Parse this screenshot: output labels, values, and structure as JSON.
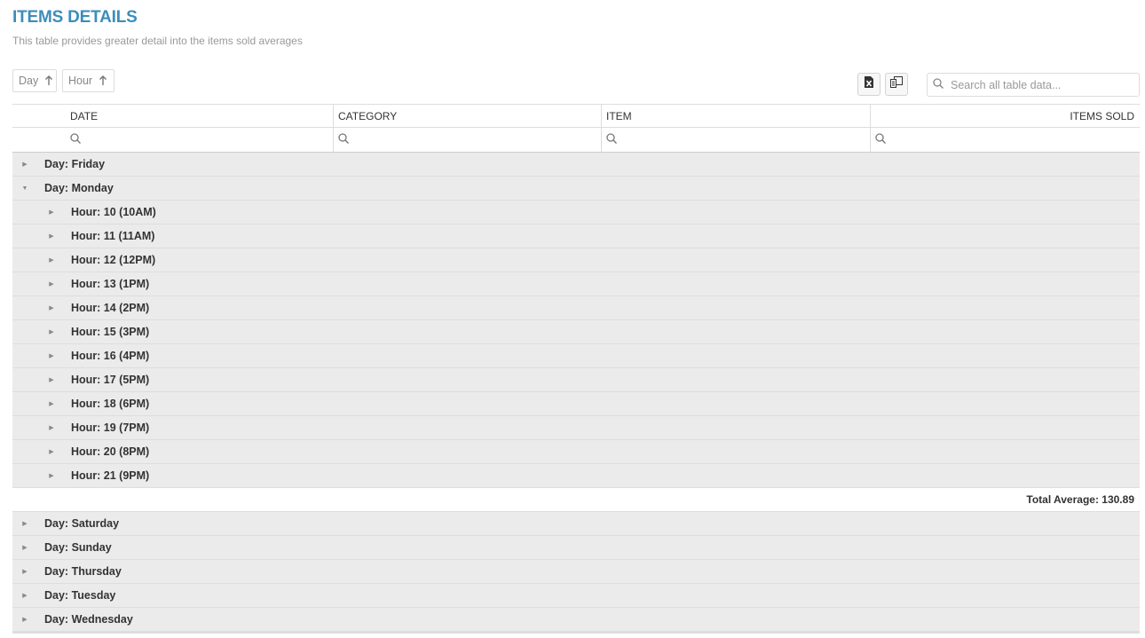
{
  "header": {
    "title": "ITEMS DETAILS",
    "subtitle": "This table provides greater detail into the items sold averages"
  },
  "grouping": {
    "chips": [
      {
        "label": "Day",
        "arrow": "🠕"
      },
      {
        "label": "Hour",
        "arrow": "🠕"
      }
    ]
  },
  "toolbar": {
    "export_icon": "excel-export-icon",
    "columns_icon": "column-chooser-icon"
  },
  "search": {
    "placeholder": "Search all table data..."
  },
  "columns": [
    "DATE",
    "CATEGORY",
    "ITEM",
    "ITEMS SOLD"
  ],
  "groups": {
    "friday": "Day: Friday",
    "monday": "Day: Monday",
    "monday_hours": [
      "Hour: 10 (10AM)",
      "Hour: 11 (11AM)",
      "Hour: 12 (12PM)",
      "Hour: 13 (1PM)",
      "Hour: 14 (2PM)",
      "Hour: 15 (3PM)",
      "Hour: 16 (4PM)",
      "Hour: 17 (5PM)",
      "Hour: 18 (6PM)",
      "Hour: 19 (7PM)",
      "Hour: 20 (8PM)",
      "Hour: 21 (9PM)"
    ],
    "monday_total": "Total Average: 130.89",
    "others": [
      "Day: Saturday",
      "Day: Sunday",
      "Day: Thursday",
      "Day: Tuesday",
      "Day: Wednesday"
    ]
  },
  "colors": {
    "accent": "#3c8dbc",
    "group_bg": "#ebebeb"
  }
}
